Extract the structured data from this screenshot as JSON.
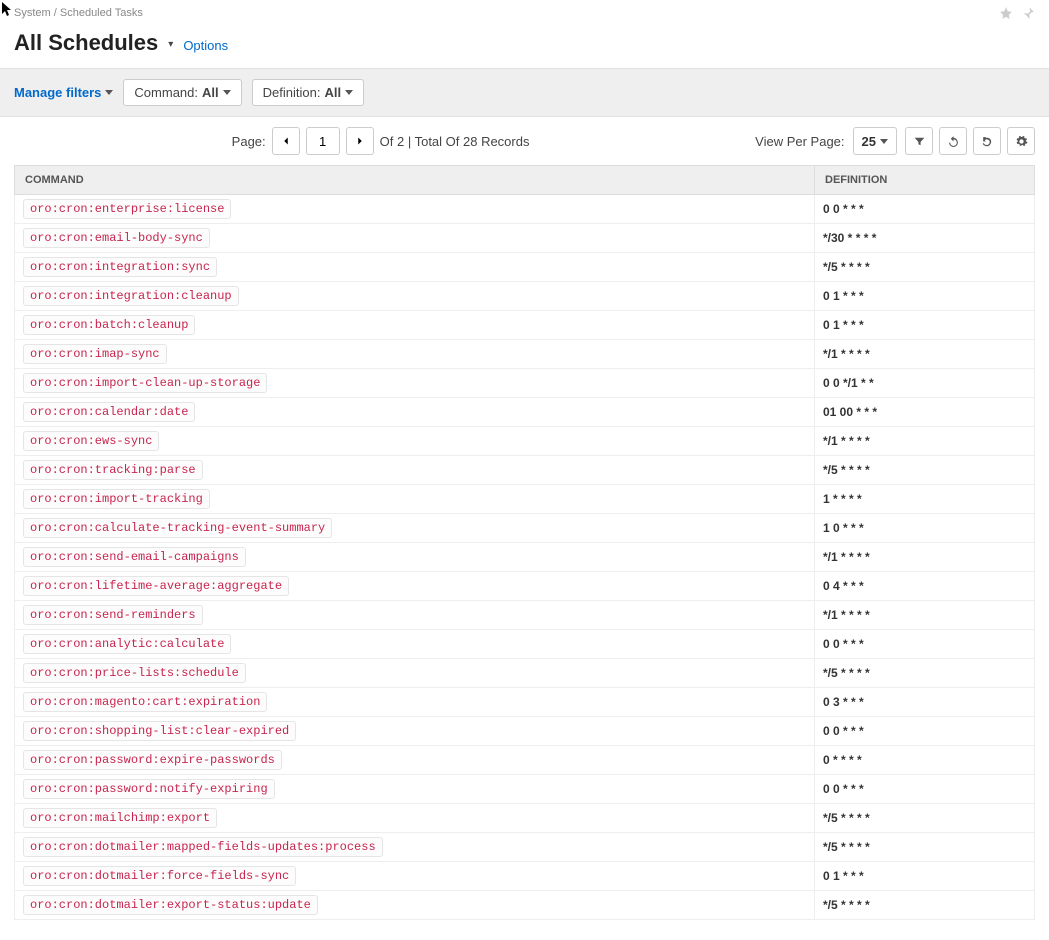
{
  "breadcrumb": {
    "system": "System",
    "sep": "/",
    "page": "Scheduled Tasks"
  },
  "title": "All Schedules",
  "options_link": "Options",
  "filters": {
    "manage": "Manage filters",
    "f1_label": "Command:",
    "f1_value": "All",
    "f2_label": "Definition:",
    "f2_value": "All"
  },
  "pager": {
    "page_label": "Page:",
    "current": "1",
    "of_text": "Of 2 | Total Of 28 Records",
    "view_per_page": "View Per Page:",
    "per_page": "25"
  },
  "columns": {
    "command": "COMMAND",
    "definition": "DEFINITION"
  },
  "rows": [
    {
      "cmd": "oro:cron:enterprise:license",
      "def": "0 0 * * *"
    },
    {
      "cmd": "oro:cron:email-body-sync",
      "def": "*/30 * * * *"
    },
    {
      "cmd": "oro:cron:integration:sync",
      "def": "*/5 * * * *"
    },
    {
      "cmd": "oro:cron:integration:cleanup",
      "def": "0 1 * * *"
    },
    {
      "cmd": "oro:cron:batch:cleanup",
      "def": "0 1 * * *"
    },
    {
      "cmd": "oro:cron:imap-sync",
      "def": "*/1 * * * *"
    },
    {
      "cmd": "oro:cron:import-clean-up-storage",
      "def": "0 0 */1 * *"
    },
    {
      "cmd": "oro:cron:calendar:date",
      "def": "01 00 * * *"
    },
    {
      "cmd": "oro:cron:ews-sync",
      "def": "*/1 * * * *"
    },
    {
      "cmd": "oro:cron:tracking:parse",
      "def": "*/5 * * * *"
    },
    {
      "cmd": "oro:cron:import-tracking",
      "def": "1 * * * *"
    },
    {
      "cmd": "oro:cron:calculate-tracking-event-summary",
      "def": "1 0 * * *"
    },
    {
      "cmd": "oro:cron:send-email-campaigns",
      "def": "*/1 * * * *"
    },
    {
      "cmd": "oro:cron:lifetime-average:aggregate",
      "def": "0 4 * * *"
    },
    {
      "cmd": "oro:cron:send-reminders",
      "def": "*/1 * * * *"
    },
    {
      "cmd": "oro:cron:analytic:calculate",
      "def": "0 0 * * *"
    },
    {
      "cmd": "oro:cron:price-lists:schedule",
      "def": "*/5 * * * *"
    },
    {
      "cmd": "oro:cron:magento:cart:expiration",
      "def": "0 3 * * *"
    },
    {
      "cmd": "oro:cron:shopping-list:clear-expired",
      "def": "0 0 * * *"
    },
    {
      "cmd": "oro:cron:password:expire-passwords",
      "def": "0 * * * *"
    },
    {
      "cmd": "oro:cron:password:notify-expiring",
      "def": "0 0 * * *"
    },
    {
      "cmd": "oro:cron:mailchimp:export",
      "def": "*/5 * * * *"
    },
    {
      "cmd": "oro:cron:dotmailer:mapped-fields-updates:process",
      "def": "*/5 * * * *"
    },
    {
      "cmd": "oro:cron:dotmailer:force-fields-sync",
      "def": "0 1 * * *"
    },
    {
      "cmd": "oro:cron:dotmailer:export-status:update",
      "def": "*/5 * * * *"
    }
  ]
}
